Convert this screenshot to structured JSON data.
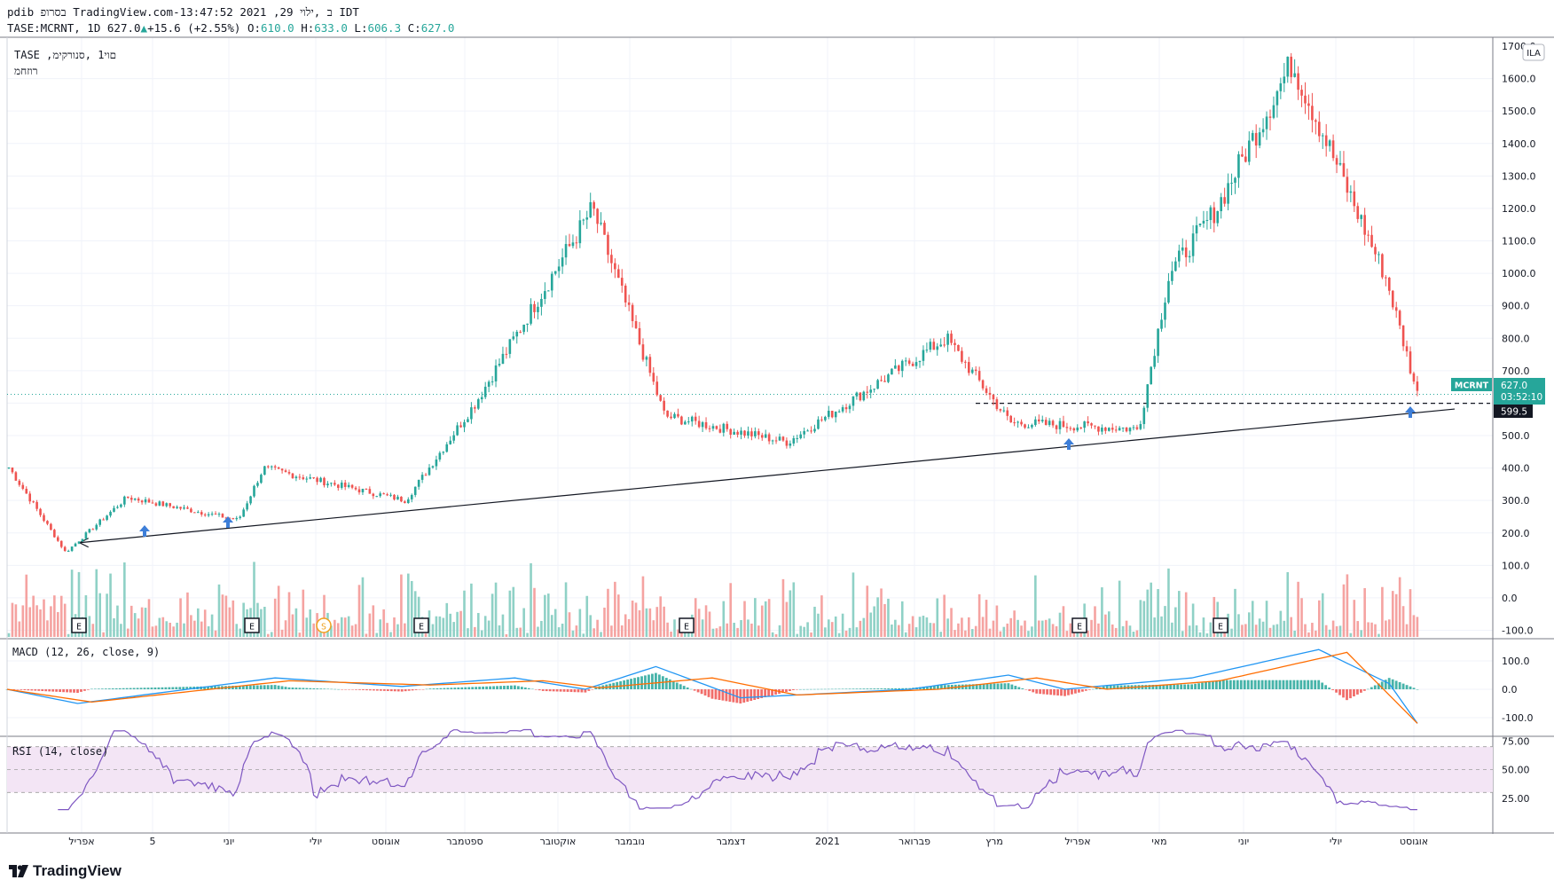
{
  "header": {
    "line1": "pdib בסרופ TradingView.com-ב ,ילוי 29, 2021 13:47:52 IDT",
    "symbol": "TASE:MCRNT, 1D",
    "last": "627.0",
    "change_arrow": "▲",
    "change": "+15.6 (+2.55%)",
    "o_label": "O:",
    "o_value": "610.0",
    "h_label": "H:",
    "h_value": "633.0",
    "l_label": "L:",
    "l_value": "606.3",
    "c_label": "C:",
    "c_value": "627.0"
  },
  "legend": {
    "series_title": "TASE ,םוי1 ,סנורקימ",
    "volume_title": "רוזחמ"
  },
  "currency_badge": "ILA",
  "last_price_tag": {
    "symbol": "MCRNT",
    "price": "627.0",
    "countdown": "03:52:10"
  },
  "level_tag": "599.5",
  "price_axis_top": "1700.0",
  "macd_title": "MACD (12, 26, close, 9)",
  "rsi_title": "RSI (14, close)",
  "event_markers": [
    "E",
    "E",
    "S",
    "E",
    "E",
    "E",
    "E"
  ],
  "brand": "TradingView",
  "colors": {
    "up": "#26a69a",
    "down": "#ef5350",
    "macd": "#2196f3",
    "signal": "#ff6d00",
    "rsi": "#7e57c2",
    "rsi_band": "#f3e5f5",
    "arrow": "#2962ff"
  },
  "chart_data": [
    {
      "type": "candlestick",
      "title": "TASE:MCRNT, 1D",
      "y_ticks": [
        -100,
        0,
        100,
        200,
        300,
        400,
        500,
        600,
        700,
        800,
        900,
        1000,
        1100,
        1200,
        1300,
        1400,
        1500,
        1600
      ],
      "x_ticks": [
        "אפריל",
        "5",
        "יוני",
        "יולי",
        "אוגוסט",
        "ספטמבר",
        "אוקטובר",
        "נובמבר",
        "דצמבר",
        "2021",
        "פברואר",
        "מרץ",
        "אפריל",
        "מאי",
        "יוני",
        "יולי",
        "אוגוסט"
      ],
      "ylim": [
        -170,
        1720
      ],
      "key_points": [
        {
          "date": "2020-03-10",
          "close": 410
        },
        {
          "date": "2020-03-31",
          "close": 140
        },
        {
          "date": "2020-04-22",
          "close": 310
        },
        {
          "date": "2020-06-01",
          "close": 240
        },
        {
          "date": "2020-06-10",
          "close": 400
        },
        {
          "date": "2020-07-31",
          "close": 300
        },
        {
          "date": "2020-08-25",
          "close": 600
        },
        {
          "date": "2020-10-06",
          "close": 1200
        },
        {
          "date": "2020-11-01",
          "close": 560
        },
        {
          "date": "2020-12-15",
          "close": 480
        },
        {
          "date": "2021-02-10",
          "close": 800
        },
        {
          "date": "2021-03-05",
          "close": 540
        },
        {
          "date": "2021-04-20",
          "close": 520
        },
        {
          "date": "2021-05-01",
          "close": 1000
        },
        {
          "date": "2021-05-18",
          "close": 1200
        },
        {
          "date": "2021-06-14",
          "close": 1650
        },
        {
          "date": "2021-07-18",
          "close": 980
        },
        {
          "date": "2021-07-29",
          "close": 627
        }
      ],
      "last_close": 627.0,
      "dashed_level": 599.5,
      "trendline": [
        {
          "date": "2020-04-05",
          "value": 170
        },
        {
          "date": "2021-08-08",
          "value": 590
        }
      ]
    },
    {
      "type": "line",
      "title": "MACD (12, 26, close, 9)",
      "y_ticks": [
        100.0,
        0.0,
        -100.0
      ],
      "series": [
        {
          "name": "MACD",
          "points": [
            [
              0.0,
              0
            ],
            [
              0.05,
              -50
            ],
            [
              0.19,
              40
            ],
            [
              0.28,
              10
            ],
            [
              0.36,
              40
            ],
            [
              0.41,
              0
            ],
            [
              0.46,
              80
            ],
            [
              0.52,
              -30
            ],
            [
              0.64,
              0
            ],
            [
              0.71,
              50
            ],
            [
              0.75,
              0
            ],
            [
              0.84,
              40
            ],
            [
              0.93,
              140
            ],
            [
              0.98,
              20
            ],
            [
              1.0,
              -120
            ]
          ]
        },
        {
          "name": "Signal",
          "points": [
            [
              0.0,
              0
            ],
            [
              0.06,
              -45
            ],
            [
              0.2,
              30
            ],
            [
              0.3,
              15
            ],
            [
              0.38,
              30
            ],
            [
              0.42,
              5
            ],
            [
              0.5,
              40
            ],
            [
              0.56,
              -20
            ],
            [
              0.66,
              0
            ],
            [
              0.73,
              40
            ],
            [
              0.78,
              0
            ],
            [
              0.86,
              30
            ],
            [
              0.95,
              130
            ],
            [
              1.0,
              -120
            ]
          ]
        }
      ]
    },
    {
      "type": "line",
      "title": "RSI (14, close)",
      "y_ticks": [
        75.0,
        50.0,
        25.0
      ],
      "ylim": [
        0,
        100
      ],
      "band": [
        30,
        70
      ]
    }
  ]
}
